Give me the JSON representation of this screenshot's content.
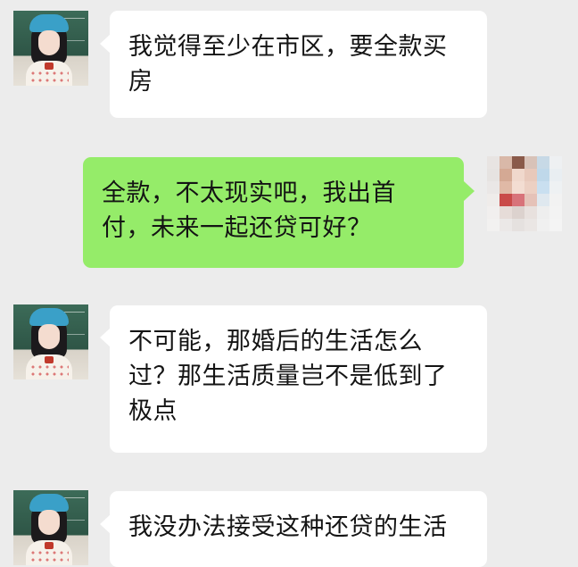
{
  "colors": {
    "background": "#ececec",
    "incoming_bubble": "#ffffff",
    "outgoing_bubble": "#95ec69",
    "text": "#141414"
  },
  "messages": [
    {
      "direction": "incoming",
      "avatar": "girl-avatar",
      "lines": [
        "我觉得至少在市区，要全款买",
        "房"
      ]
    },
    {
      "direction": "outgoing",
      "avatar": "pixelated-avatar",
      "lines": [
        "全款，不太现实吧，我出首",
        "付，未来一起还贷可好？"
      ]
    },
    {
      "direction": "incoming",
      "avatar": "girl-avatar",
      "lines": [
        "不可能，那婚后的生活怎么",
        "过？那生活质量岂不是低到了",
        "极点"
      ]
    },
    {
      "direction": "incoming",
      "avatar": "girl-avatar",
      "lines": [
        "我没办法接受这种还贷的生活"
      ]
    }
  ]
}
